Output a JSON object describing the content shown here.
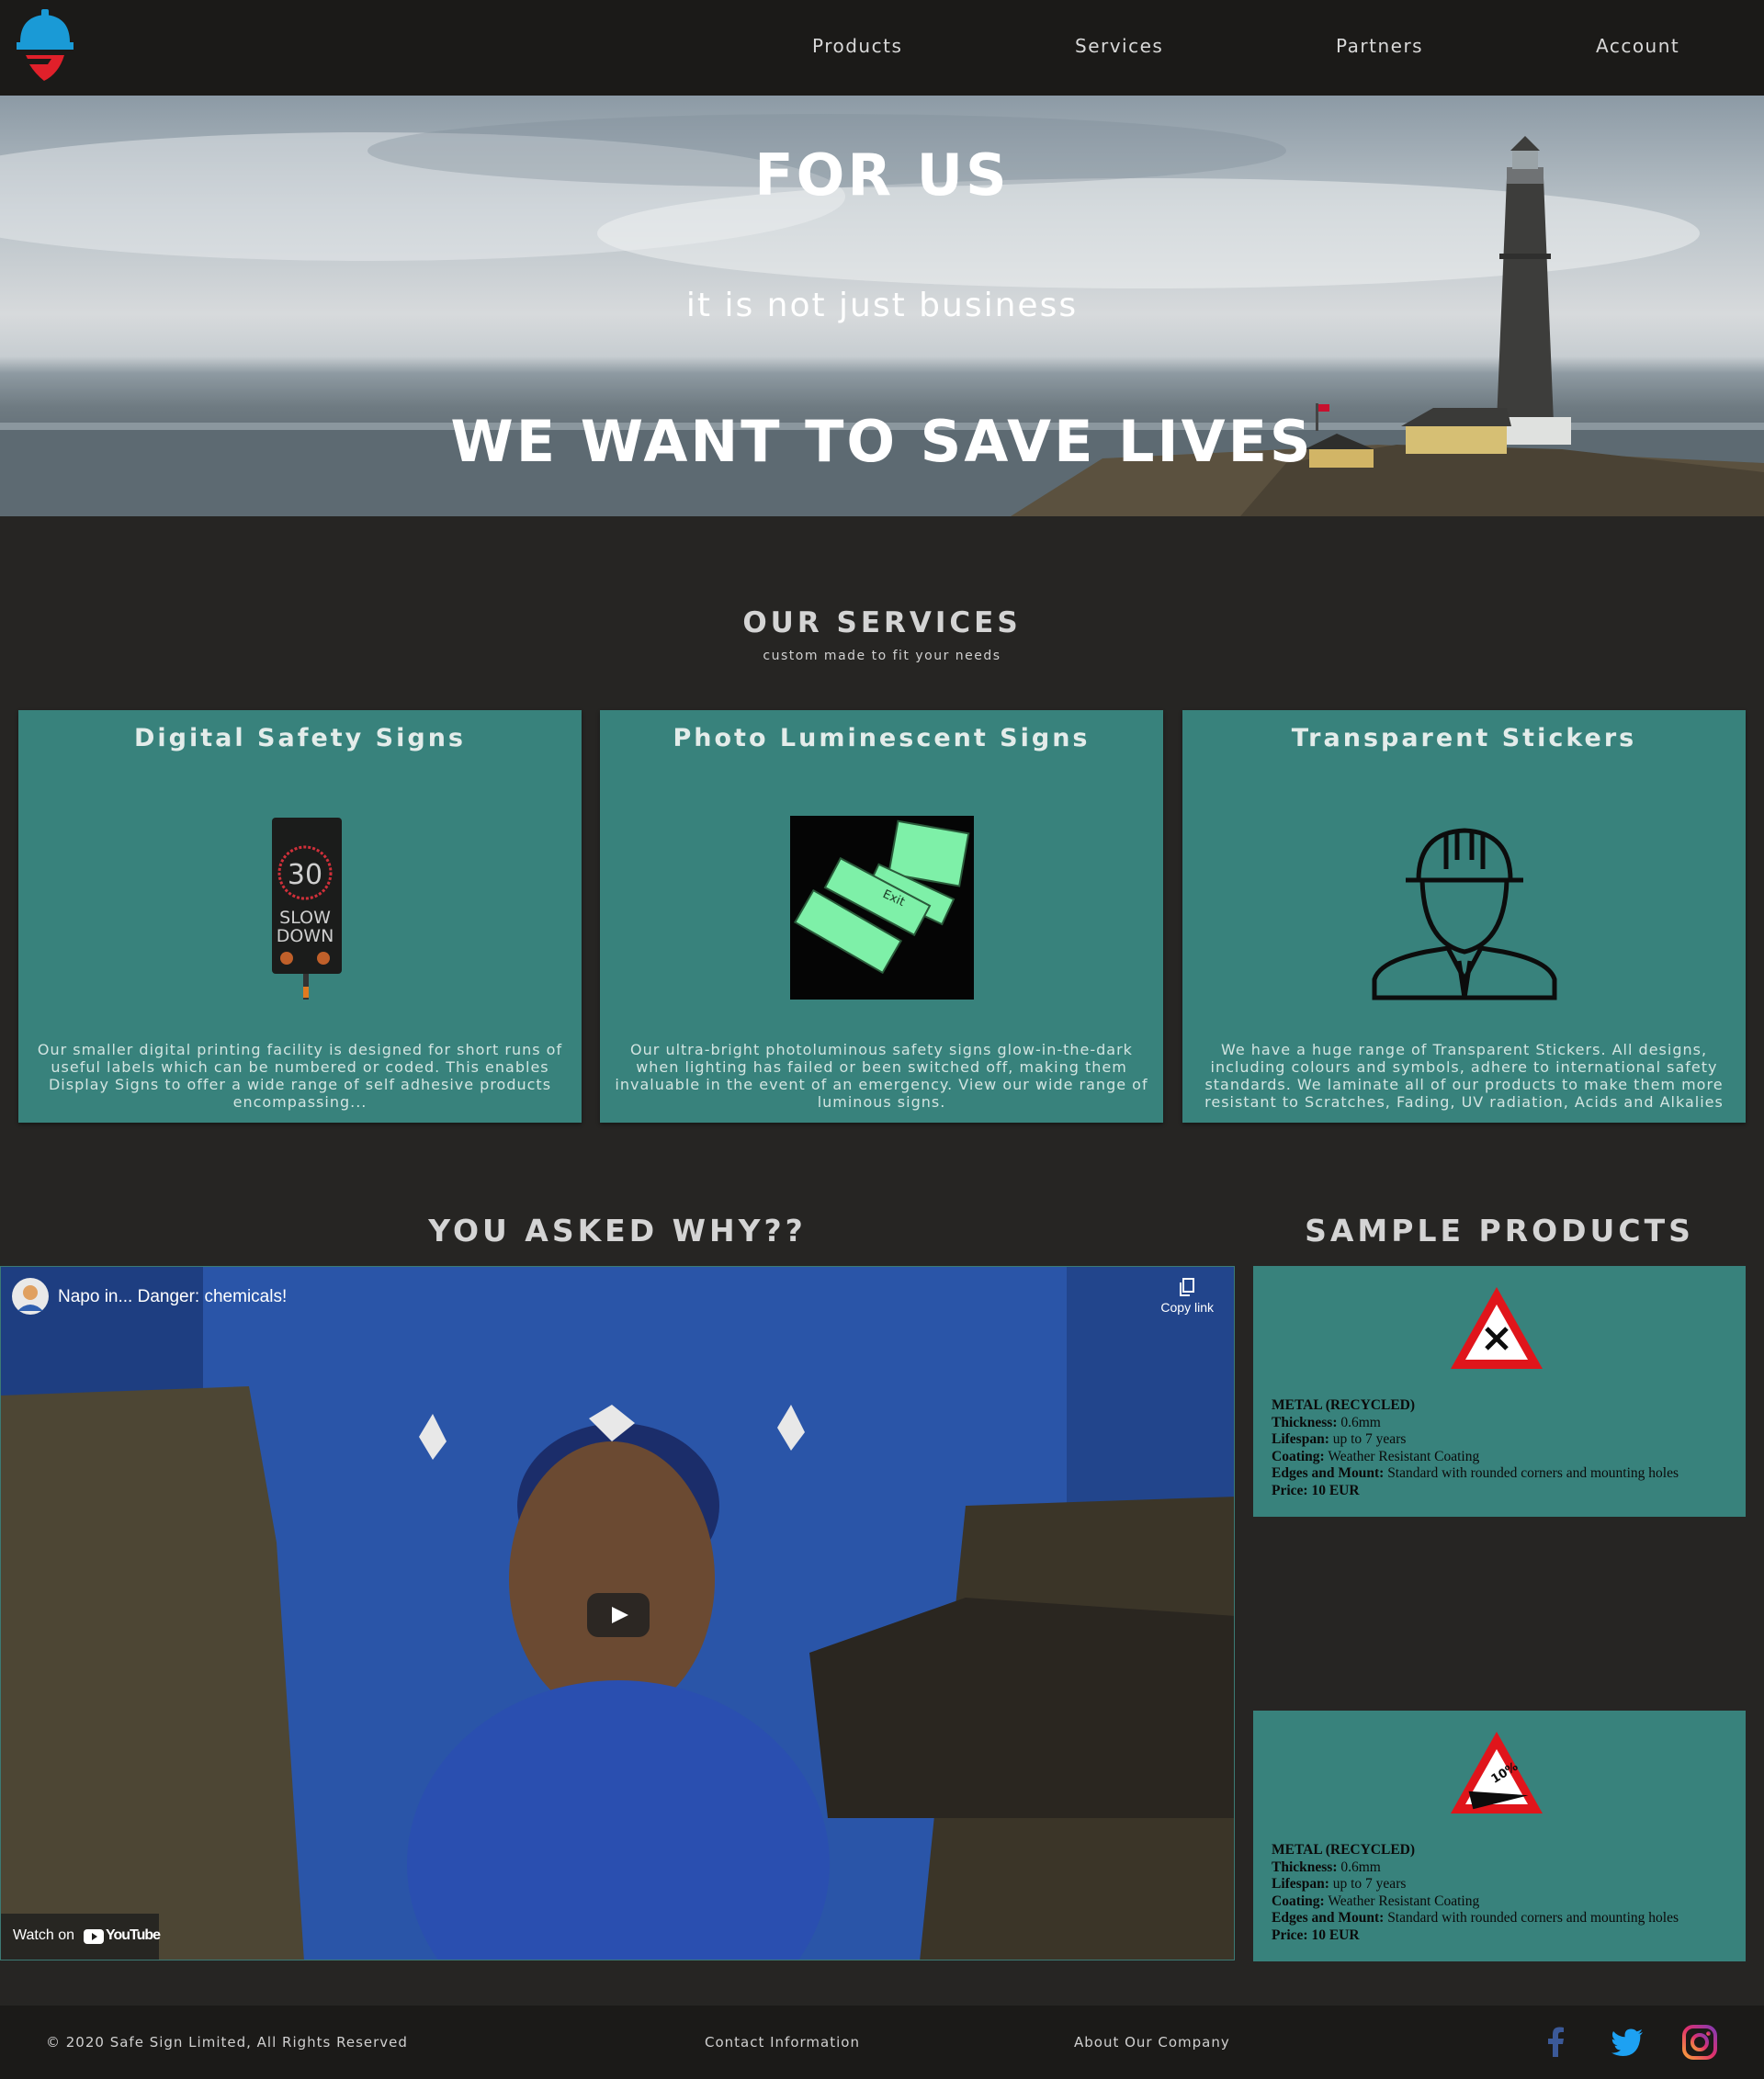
{
  "nav": {
    "items": [
      "Products",
      "Services",
      "Partners",
      "Account"
    ]
  },
  "hero": {
    "title": "FOR US",
    "subtitle": "it is not just business",
    "tagline": "WE WANT TO SAVE LIVES"
  },
  "services": {
    "title": "OUR SERVICES",
    "subtitle": "custom made to fit your needs",
    "cards": [
      {
        "title": "Digital Safety Signs",
        "sign_number": "30",
        "sign_text_1": "SLOW",
        "sign_text_2": "DOWN",
        "text": "Our smaller digital printing facility is designed for short runs of useful labels which can be numbered or coded. This enables Display Signs to offer a wide range of self adhesive products encompassing..."
      },
      {
        "title": "Photo Luminescent Signs",
        "sign_label": "Exit",
        "text": "Our ultra-bright photoluminous safety signs glow-in-the-dark when lighting has failed or been switched off, making them invaluable in the event of an emergency. View our wide range of luminous signs."
      },
      {
        "title": "Transparent Stickers",
        "text": "We have a huge range of Transparent Stickers. All designs, including colours and symbols, adhere to international safety standards. We laminate all of our products to make them more resistant to Scratches, Fading, UV radiation, Acids and Alkalies"
      }
    ]
  },
  "why": {
    "title": "YOU ASKED WHY??",
    "video_title": "Napo in... Danger: chemicals!",
    "copy_link": "Copy link",
    "watch_on": "Watch on",
    "youtube": "YouTube"
  },
  "samples": {
    "title": "SAMPLE PRODUCTS",
    "products": [
      {
        "sign_text": "",
        "material": "METAL (RECYCLED)",
        "thickness_label": "Thickness:",
        "thickness": "0.6mm",
        "lifespan_label": "Lifespan:",
        "lifespan": "up to 7 years",
        "coating_label": "Coating:",
        "coating": "Weather Resistant Coating",
        "edges_label": "Edges and Mount:",
        "edges": "Standard with rounded corners and mounting holes",
        "price": "Price: 10 EUR"
      },
      {
        "sign_text": "10%",
        "material": "METAL (RECYCLED)",
        "thickness_label": "Thickness:",
        "thickness": "0.6mm",
        "lifespan_label": "Lifespan:",
        "lifespan": "up to 7 years",
        "coating_label": "Coating:",
        "coating": "Weather Resistant Coating",
        "edges_label": "Edges and Mount:",
        "edges": "Standard with rounded corners and mounting holes",
        "price": "Price: 10 EUR"
      }
    ]
  },
  "footer": {
    "copyright": "© 2020 Safe Sign Limited, All Rights Reserved",
    "contact": "Contact Information",
    "about": "About Our Company"
  },
  "colors": {
    "nav_bg": "#1b1a18",
    "page_bg": "#262523",
    "card_teal": "#38827c",
    "logo_blue": "#1a9ad6",
    "logo_red": "#e0202a"
  }
}
